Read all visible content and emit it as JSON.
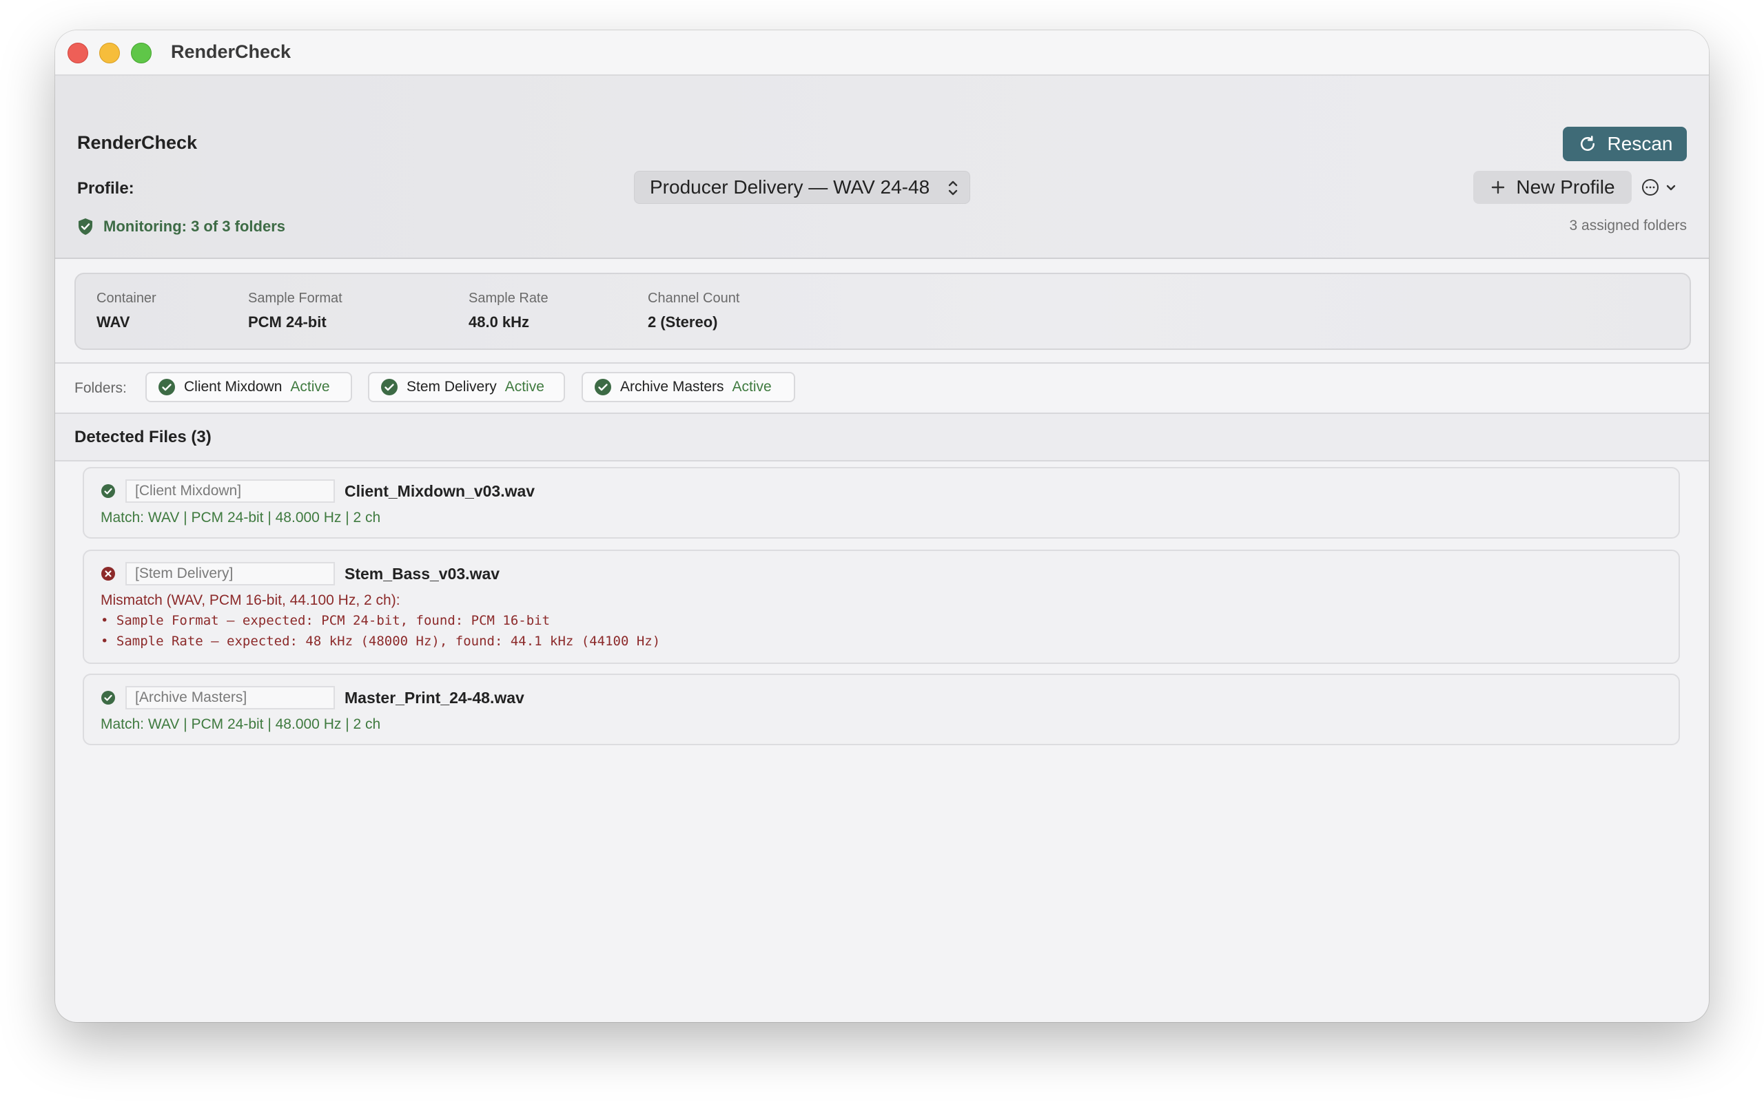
{
  "window": {
    "title": "RenderCheck"
  },
  "header": {
    "app_name": "RenderCheck",
    "rescan_label": "Rescan",
    "profile_label": "Profile:",
    "profile_selected": "Producer Delivery — WAV 24-48",
    "new_profile_label": "New Profile",
    "monitoring_text": "Monitoring: 3 of 3 folders",
    "assigned_folders": "3 assigned folders"
  },
  "specs": [
    {
      "label": "Container",
      "value": "WAV"
    },
    {
      "label": "Sample Format",
      "value": "PCM 24-bit"
    },
    {
      "label": "Sample Rate",
      "value": "48.0 kHz"
    },
    {
      "label": "Channel Count",
      "value": "2 (Stereo)"
    }
  ],
  "folders": {
    "label": "Folders:",
    "items": [
      {
        "name": "Client Mixdown",
        "status": "Active"
      },
      {
        "name": "Stem Delivery",
        "status": "Active"
      },
      {
        "name": "Archive Masters",
        "status": "Active"
      }
    ]
  },
  "detected": {
    "title": "Detected Files (3)",
    "files": [
      {
        "status": "match",
        "folder": "[Client Mixdown]",
        "name": "Client_Mixdown_v03.wav",
        "detail": "Match: WAV | PCM 24-bit | 48.000 Hz | 2 ch"
      },
      {
        "status": "mismatch",
        "folder": "[Stem Delivery]",
        "name": "Stem_Bass_v03.wav",
        "detail": "Mismatch (WAV, PCM 16-bit, 44.100 Hz, 2 ch):",
        "issues": [
          "• Sample Format — expected: PCM 24-bit, found: PCM 16-bit",
          "• Sample Rate — expected: 48 kHz (48000 Hz), found: 44.1 kHz (44100 Hz)"
        ]
      },
      {
        "status": "match",
        "folder": "[Archive Masters]",
        "name": "Master_Print_24-48.wav",
        "detail": "Match: WAV | PCM 24-bit | 48.000 Hz | 2 ch"
      }
    ]
  },
  "colors": {
    "accent": "#3f6b77",
    "ok_green": "#3d6b45",
    "error_red": "#8c2a2a"
  }
}
